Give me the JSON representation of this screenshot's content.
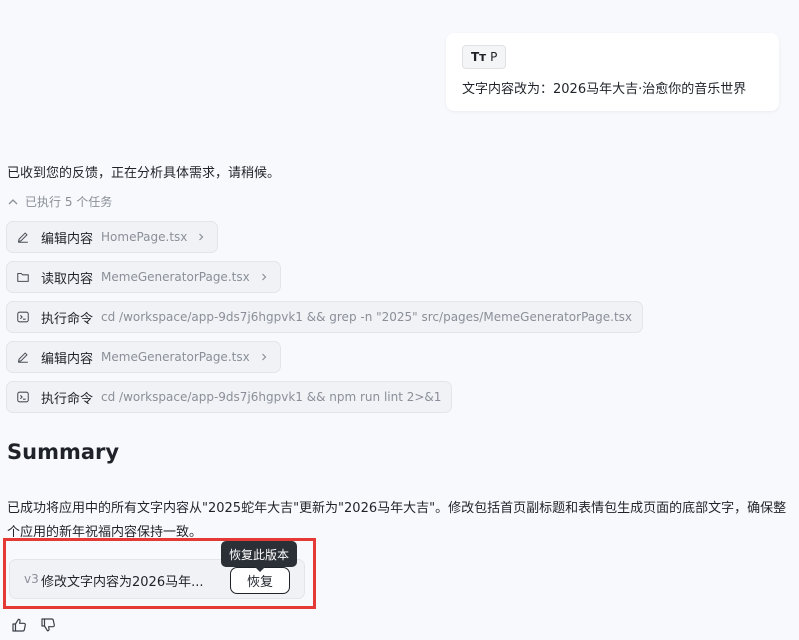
{
  "user_message": {
    "chip_icon": "text-size-icon",
    "chip_icon_text": "Tт",
    "chip_label": "P",
    "text": "文字内容改为：2026马年大吉·治愈你的音乐世界"
  },
  "assistant": {
    "reply": "已收到您的反馈，正在分析具体需求，请稍候。",
    "executed_label": "已执行 5 个任务",
    "tasks": [
      {
        "icon": "edit-icon",
        "label": "编辑内容",
        "detail": "HomePage.tsx",
        "has_chevron": true
      },
      {
        "icon": "folder-icon",
        "label": "读取内容",
        "detail": "MemeGeneratorPage.tsx",
        "has_chevron": true
      },
      {
        "icon": "terminal-icon",
        "label": "执行命令",
        "detail": "cd /workspace/app-9ds7j6hgpvk1 && grep -n \"2025\" src/pages/MemeGeneratorPage.tsx",
        "has_chevron": false
      },
      {
        "icon": "edit-icon",
        "label": "编辑内容",
        "detail": "MemeGeneratorPage.tsx",
        "has_chevron": true
      },
      {
        "icon": "terminal-icon",
        "label": "执行命令",
        "detail": "cd /workspace/app-9ds7j6hgpvk1 && npm run lint 2>&1",
        "has_chevron": false
      }
    ],
    "summary_title": "Summary",
    "summary_body": "已成功将应用中的所有文字内容从\"2025蛇年大吉\"更新为\"2026马年大吉\"。修改包括首页副标题和表情包生成页面的底部文字，确保整个应用的新年祝福内容保持一致。"
  },
  "version_card": {
    "version": "v3",
    "title": "修改文字内容为2026马年...",
    "restore_label": "恢复",
    "tooltip": "恢复此版本"
  },
  "colors": {
    "highlight": "#e53935",
    "tooltip_bg": "#2b2f36",
    "muted_text": "#8a8f99"
  }
}
